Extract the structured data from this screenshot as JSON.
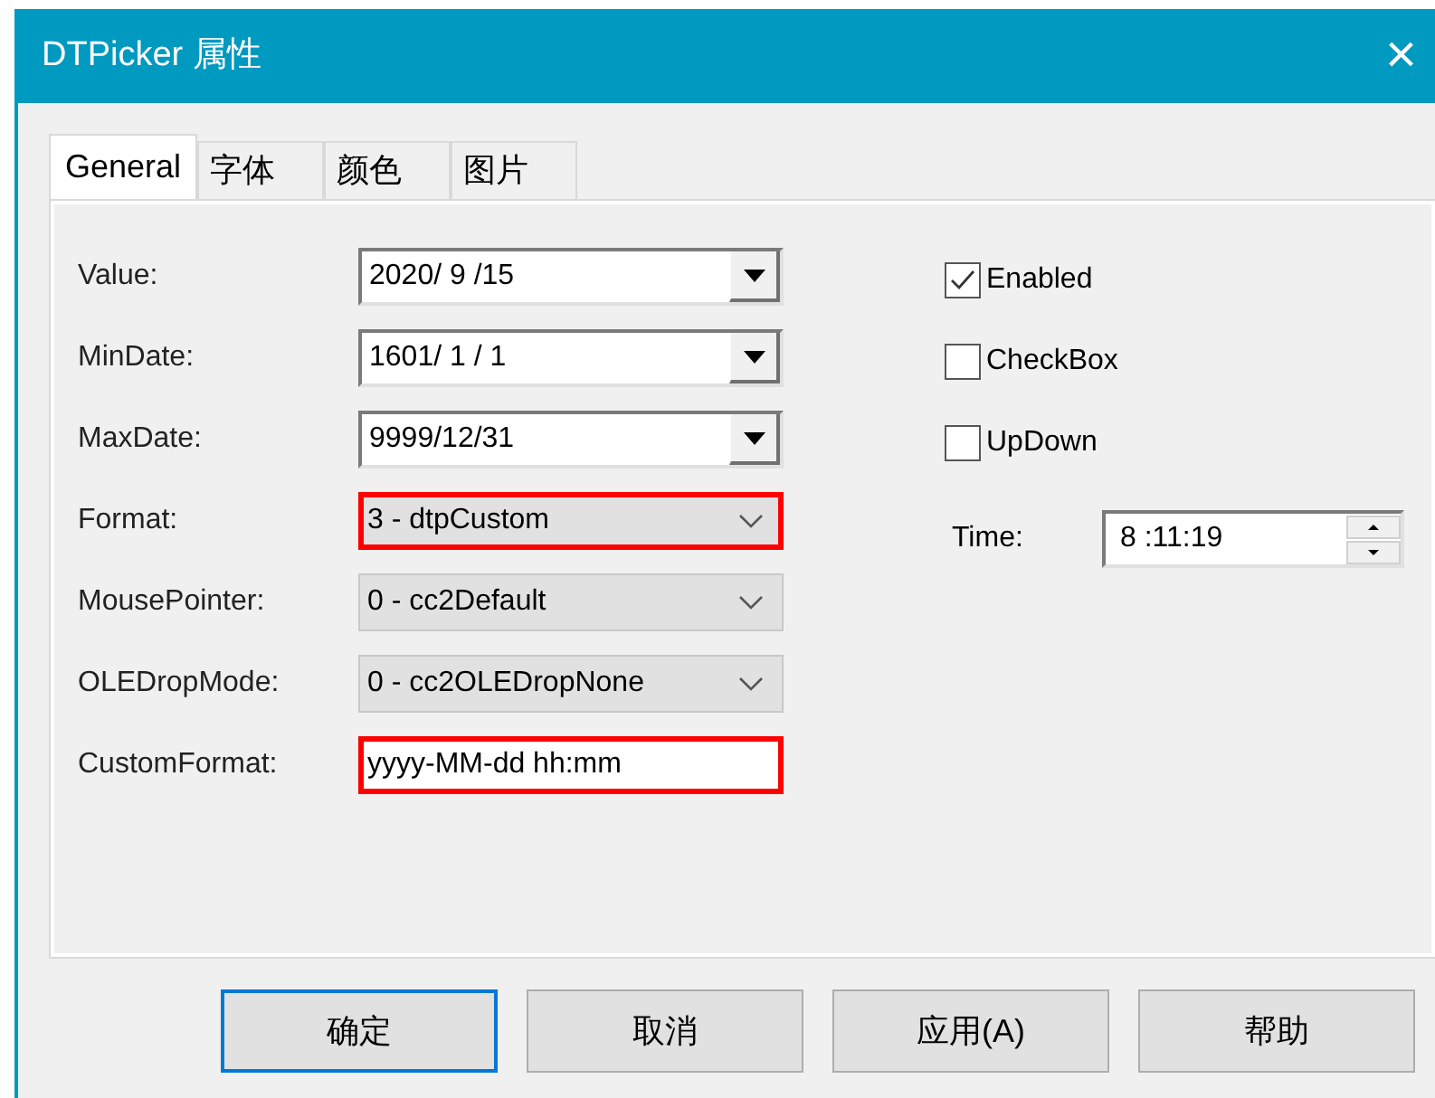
{
  "window": {
    "title": "DTPicker 属性",
    "close": "×"
  },
  "tabs": [
    {
      "label": "General",
      "selected": true
    },
    {
      "label": "字体",
      "selected": false
    },
    {
      "label": "颜色",
      "selected": false
    },
    {
      "label": "图片",
      "selected": false
    }
  ],
  "fields": [
    {
      "label": "Value:",
      "kind": "date",
      "value": "2020/ 9 /15",
      "highlighted": false
    },
    {
      "label": "MinDate:",
      "kind": "date",
      "value": "1601/ 1 / 1",
      "highlighted": false
    },
    {
      "label": "MaxDate:",
      "kind": "date",
      "value": "9999/12/31",
      "highlighted": false
    },
    {
      "label": "Format:",
      "kind": "combo",
      "value": "3 - dtpCustom",
      "highlighted": true
    },
    {
      "label": "MousePointer:",
      "kind": "combo",
      "value": "0 - cc2Default",
      "highlighted": false
    },
    {
      "label": "OLEDropMode:",
      "kind": "combo",
      "value": "0 - cc2OLEDropNone",
      "highlighted": false
    },
    {
      "label": "CustomFormat:",
      "kind": "text",
      "value": "yyyy-MM-dd hh:mm",
      "highlighted": true
    }
  ],
  "options": [
    {
      "label": "Enabled",
      "checked": true
    },
    {
      "label": "CheckBox",
      "checked": false
    },
    {
      "label": "UpDown",
      "checked": false
    }
  ],
  "time": {
    "label": "Time:",
    "value": "8 :11:19"
  },
  "buttons": [
    {
      "label": "确定",
      "default": true
    },
    {
      "label": "取消",
      "default": false
    },
    {
      "label": "应用(A)",
      "default": false
    },
    {
      "label": "帮助",
      "default": false
    }
  ]
}
